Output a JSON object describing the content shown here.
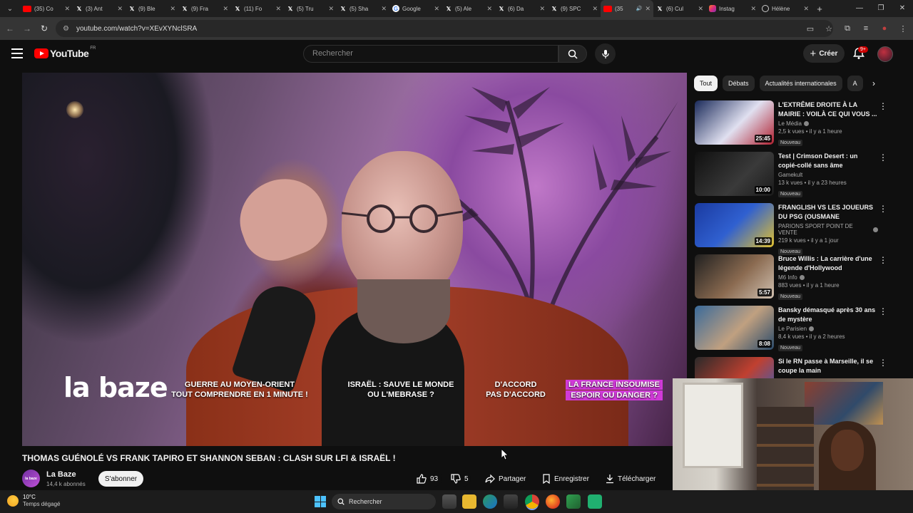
{
  "browser": {
    "tabs": [
      {
        "label": "(35) Co",
        "icon": "youtube-icon",
        "color": "#ff0000"
      },
      {
        "label": "(3) Ant",
        "icon": "x-icon",
        "color": "#ffffff"
      },
      {
        "label": "(9) Ble",
        "icon": "x-icon",
        "color": "#ffffff"
      },
      {
        "label": "(9) Fra",
        "icon": "x-icon",
        "color": "#ffffff"
      },
      {
        "label": "(11) Fo",
        "icon": "x-icon",
        "color": "#ffffff"
      },
      {
        "label": "(5) Tru",
        "icon": "x-icon",
        "color": "#ffffff"
      },
      {
        "label": "(5) Sha",
        "icon": "x-icon",
        "color": "#ffffff"
      },
      {
        "label": "Google",
        "icon": "google-icon",
        "color": "#4285f4"
      },
      {
        "label": "(5) Ale",
        "icon": "x-icon",
        "color": "#ffffff"
      },
      {
        "label": "(6) Da",
        "icon": "x-icon",
        "color": "#ffffff"
      },
      {
        "label": "(9) SPC",
        "icon": "x-icon",
        "color": "#ffffff"
      },
      {
        "label": "(35",
        "icon": "youtube-icon",
        "color": "#ff0000",
        "active": true
      },
      {
        "label": "(6) Cul",
        "icon": "x-icon",
        "color": "#ffffff"
      },
      {
        "label": "Instag",
        "icon": "instagram-icon",
        "color": "#e1306c"
      },
      {
        "label": "Hélène",
        "icon": "globe-icon",
        "color": "#cccccc"
      }
    ],
    "url": "youtube.com/watch?v=XEvXYNclSRA"
  },
  "yt_header": {
    "logo_word": "YouTube",
    "logo_region": "FR",
    "search_placeholder": "Rechercher",
    "create_label": "Créer",
    "notif_badge": "9+"
  },
  "video": {
    "overlay": {
      "brand": "la baze",
      "items": [
        {
          "line1": "GUERRE AU MOYEN-ORIENT",
          "line2": "TOUT COMPRENDRE EN 1 MINUTE !"
        },
        {
          "line1": "ISRAËL : SAUVE LE MONDE",
          "line2": "OU L'MEBRASE ?"
        },
        {
          "line1": "D'ACCORD",
          "line2": "PAS D'ACCORD"
        },
        {
          "line1": "LA FRANCE INSOUMISE",
          "line2": "ESPOIR OU DANGER ?"
        }
      ]
    },
    "title": "THOMAS GUÉNOLÉ VS FRANK TAPIRO ET SHANNON SEBAN : CLASH SUR LFI & ISRAËL !",
    "channel": {
      "avatar_text": "la baze",
      "name": "La Baze",
      "subs": "14,4 k abonnés"
    },
    "subscribe_label": "S'abonner",
    "likes": "93",
    "dislikes": "5",
    "share_label": "Partager",
    "save_label": "Enregistrer",
    "download_label": "Télécharger"
  },
  "sidebar": {
    "chips": [
      "Tout",
      "Débats",
      "Actualités internationales",
      "A"
    ],
    "recommendations": [
      {
        "title": "L'EXTRÊME DROITE À LA MAIRIE : VOILÀ CE QUI VOUS ...",
        "channel": "Le Média",
        "verified": true,
        "stats": "2,5 k vues • il y a 1 heure",
        "badge": "Nouveau",
        "duration": "25:45",
        "thumb": "linear-gradient(135deg,#1a2a5a,#e0e0f0 55%,#b02030)"
      },
      {
        "title": "Test | Crimson Desert : un copié-collé sans âme",
        "channel": "Gamekult",
        "verified": false,
        "stats": "13 k vues • il y a 23 heures",
        "badge": "Nouveau",
        "duration": "10:00",
        "thumb": "linear-gradient(135deg,#101010,#3a3a3a 60%,#1a1a1a)"
      },
      {
        "title": "FRANGLISH VS LES JOUEURS DU PSG (OUSMANE DEMBÉLÉ,...",
        "channel": "PARIONS SPORT POINT DE VENTE",
        "verified": true,
        "stats": "219 k vues • il y a 1 jour",
        "badge": "Nouveau",
        "duration": "14:39",
        "thumb": "linear-gradient(135deg,#1a3aa0,#3060d0 50%,#e0c030)"
      },
      {
        "title": "Bruce Willis : La carrière d'une légende d'Hollywood",
        "channel": "M6 Info",
        "verified": true,
        "stats": "883 vues • il y a 1 heure",
        "badge": "Nouveau",
        "duration": "5:57",
        "thumb": "linear-gradient(135deg,#202020,#8a6a50 55%,#d0c0b0)"
      },
      {
        "title": "Bansky démasqué après 30 ans de mystère",
        "channel": "Le Parisien",
        "verified": true,
        "stats": "8,4 k vues • il y a 2 heures",
        "badge": "Nouveau",
        "duration": "8:08",
        "thumb": "linear-gradient(135deg,#3a6a9a,#c0a080 55%,#2a4a6a)"
      },
      {
        "title": "Si le RN passe à Marseille, il se coupe la main",
        "channel": "",
        "verified": false,
        "stats": "",
        "badge": "",
        "duration": "",
        "thumb": "linear-gradient(135deg,#2a2a2a,#c04030 55%,#3060c0)"
      }
    ]
  },
  "taskbar": {
    "temperature": "10°C",
    "weather": "Temps dégagé",
    "search_label": "Rechercher"
  }
}
